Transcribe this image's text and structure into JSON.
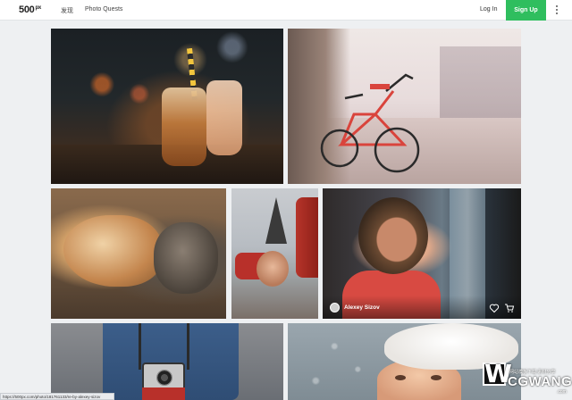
{
  "header": {
    "logo_text": "500",
    "logo_sup": "px",
    "nav": [
      {
        "label": "发现"
      },
      {
        "label": "Photo Quests"
      }
    ],
    "login_label": "Log In",
    "signup_label": "Sign Up",
    "more_icon": "more-vertical-icon"
  },
  "gallery": {
    "photos": [
      {
        "subject": "drinks in jars with straws"
      },
      {
        "subject": "red bicycle on street"
      },
      {
        "subject": "dog and cat sleeping"
      },
      {
        "subject": "child lying down with Eiffel Tower"
      },
      {
        "subject": "girl by window",
        "author": "Alexey Sizov",
        "icons": [
          "heart-icon",
          "cart-icon"
        ]
      },
      {
        "subject": "person with camera in blue sweater"
      },
      {
        "subject": "child in white knit hat"
      }
    ]
  },
  "status_bar": {
    "url": "https://500px.com/photo/181761133/re-by-alexey-sizov"
  },
  "watermark": {
    "letter": "W",
    "small_text": "网站模板下载 素材分享",
    "brand": "CGWANG",
    "suffix": ".com"
  },
  "colors": {
    "signup_bg": "#2fbe5e",
    "page_bg": "#eef0f2"
  }
}
